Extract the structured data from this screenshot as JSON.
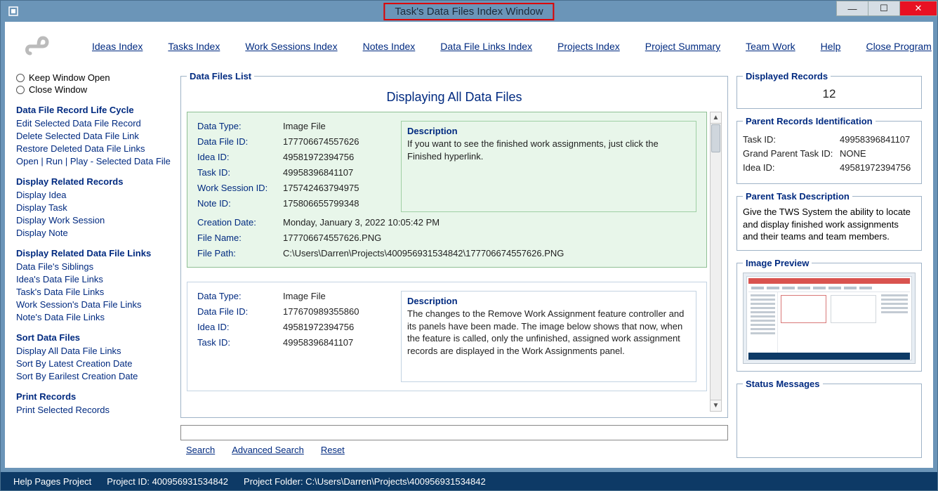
{
  "window": {
    "title": "Task's Data Files Index Window"
  },
  "menu": {
    "ideas": "Ideas Index",
    "tasks": "Tasks Index",
    "work": "Work Sessions Index",
    "notes": "Notes Index",
    "dfl": "Data File Links Index",
    "projects": "Projects Index",
    "summary": "Project Summary",
    "team": "Team Work",
    "help": "Help",
    "close": "Close Program"
  },
  "sidebar": {
    "keep_open": "Keep Window Open",
    "close_window": "Close Window",
    "groups": {
      "lifecycle": {
        "title": "Data File Record Life Cycle",
        "items": [
          "Edit Selected Data File Record",
          "Delete Selected Data File Link",
          "Restore Deleted Data File Links",
          "Open | Run | Play - Selected Data File"
        ]
      },
      "related": {
        "title": "Display Related Records",
        "items": [
          "Display Idea",
          "Display Task",
          "Display Work Session",
          "Display Note"
        ]
      },
      "links": {
        "title": "Display Related Data File Links",
        "items": [
          "Data File's Siblings",
          "Idea's Data File Links",
          "Task's Data File Links",
          "Work Session's Data File Links",
          "Note's Data File Links"
        ]
      },
      "sort": {
        "title": "Sort Data Files",
        "items": [
          "Display All Data File Links",
          "Sort By Latest Creation Date",
          "Sort By Earilest Creation Date"
        ]
      },
      "print": {
        "title": "Print Records",
        "items": [
          "Print Selected Records"
        ]
      }
    }
  },
  "list": {
    "legend": "Data Files List",
    "title": "Displaying All Data Files",
    "records": [
      {
        "data_type": "Image File",
        "data_file_id": "177706674557626",
        "idea_id": "49581972394756",
        "task_id": "49958396841107",
        "work_session_id": "175742463794975",
        "note_id": "175806655799348",
        "creation_date": "Monday, January 3, 2022  10:05:42 PM",
        "file_name": "177706674557626.PNG",
        "file_path": "C:\\Users\\Darren\\Projects\\400956931534842\\177706674557626.PNG",
        "description": "If you want to see the finished work assignments, just click the Finished hyperlink."
      },
      {
        "data_type": "Image File",
        "data_file_id": "177670989355860",
        "idea_id": "49581972394756",
        "task_id": "49958396841107",
        "description": "The changes to the Remove Work Assignment feature controller and its panels have been made. The image below shows that now, when the feature is called, only the unfinished, assigned work assignment records are displayed in the Work Assignments panel."
      }
    ]
  },
  "labels": {
    "data_type": "Data Type:",
    "data_file_id": "Data File ID:",
    "idea_id": "Idea ID:",
    "task_id": "Task ID:",
    "work_session_id": "Work Session ID:",
    "note_id": "Note ID:",
    "creation_date": "Creation Date:",
    "file_name": "File Name:",
    "file_path": "File Path:",
    "description": "Description"
  },
  "search": {
    "search": "Search",
    "advanced": "Advanced Search",
    "reset": "Reset"
  },
  "displayed": {
    "legend": "Displayed Records",
    "count": "12"
  },
  "parent_ids": {
    "legend": "Parent Records Identification",
    "task_id_label": "Task ID:",
    "task_id": "49958396841107",
    "grandparent_label": "Grand Parent Task ID:",
    "grandparent": "NONE",
    "idea_id_label": "Idea ID:",
    "idea_id": "49581972394756"
  },
  "parent_desc": {
    "legend": "Parent Task Description",
    "text": "Give the TWS System the ability to locate and display finished work assignments and their teams and team members."
  },
  "preview": {
    "legend": "Image Preview"
  },
  "status_msgs": {
    "legend": "Status Messages"
  },
  "statusbar": {
    "help": "Help Pages Project",
    "project_id": "Project ID: 400956931534842",
    "project_folder": "Project Folder: C:\\Users\\Darren\\Projects\\400956931534842"
  }
}
